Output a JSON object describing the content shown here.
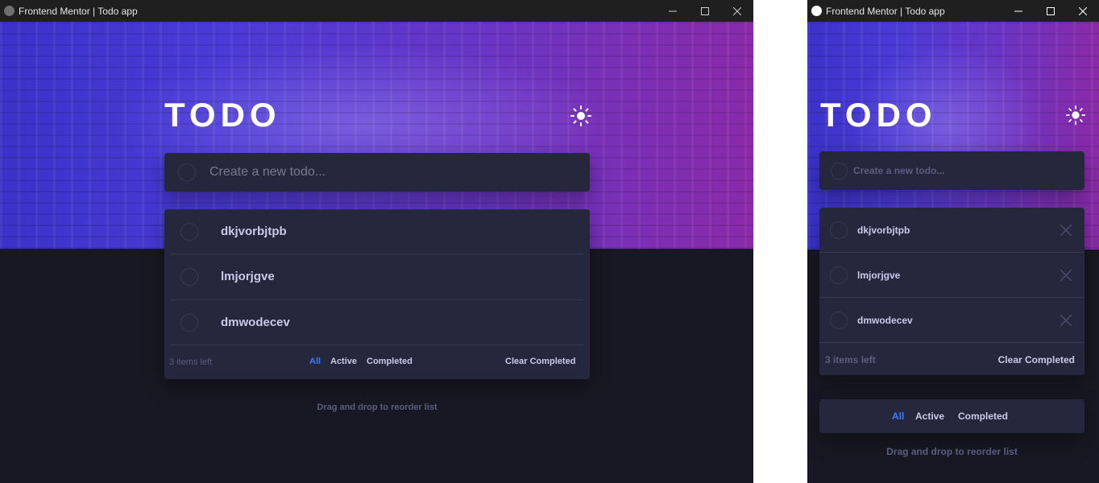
{
  "window_title": "Frontend Mentor | Todo app",
  "app": {
    "title": "TODO",
    "theme_icon": "sun-icon",
    "new_todo_placeholder": "Create a new todo...",
    "todos": [
      {
        "text": "dkjvorbjtpb",
        "completed": false
      },
      {
        "text": "lmjorjgve",
        "completed": false
      },
      {
        "text": "dmwodecev",
        "completed": false
      }
    ],
    "items_left": "3 items left",
    "filters": [
      "All",
      "Active",
      "Completed"
    ],
    "active_filter": "All",
    "clear_label": "Clear Completed",
    "hint": "Drag and drop to reorder list"
  },
  "colors": {
    "bg": "#171823",
    "card": "#25273d",
    "text": "#c8cbe7",
    "muted": "#5b5e7e",
    "accent": "#3a7cfd"
  }
}
